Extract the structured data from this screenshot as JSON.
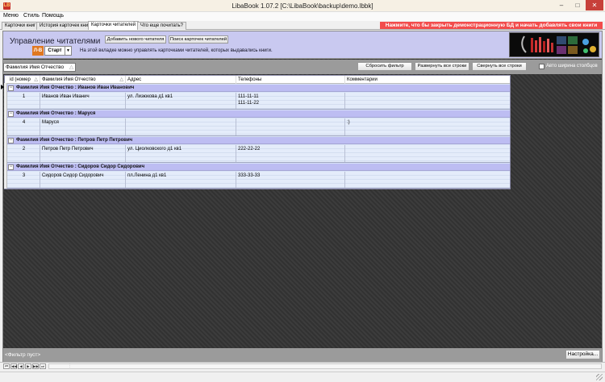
{
  "window": {
    "title": "LibaBook 1.07.2 [C:\\LibaBook\\backup\\demo.lbbk]",
    "app_icon": "LB",
    "minimize": "–",
    "maximize": "□",
    "close": "✕"
  },
  "menu": [
    "Меню",
    "Стиль",
    "Помощь"
  ],
  "tabs": [
    "Карточки книг",
    "История карточек книг",
    "Карточки читателей",
    "Что еще почитать?"
  ],
  "demo_banner": "Нажмите, что бы закрыть демонстрационную БД и начать добавлять свои книги",
  "panel": {
    "title": "Управление читателями",
    "add_button": "Добавить нового читателя",
    "search_button": "Поиск карточек читателей",
    "start_icon": "Л-В",
    "start_label": "Старт",
    "start_arrow": "▼",
    "description": "На этой вкладке можно управлять карточками читателей, которых выдавались книги."
  },
  "toolbar": {
    "filter_field": "Фамилия Имя Отчество",
    "sort_glyph": "△",
    "reset_filter": "Сбросить фильтр",
    "expand_all": "Развернуть все строки",
    "collapse_all": "Свернуть все строки",
    "auto_width_label": "Авто ширина столбцов"
  },
  "grid": {
    "columns": [
      "id (номер",
      "Фамилия Имя Отчество",
      "Адрес",
      "Телефоны",
      "Комментарии"
    ],
    "groups": [
      {
        "header": "Фамилия Имя Отчество : Иванов Иван Иванович",
        "expander": "−",
        "row": {
          "id": "1",
          "name": "Иванов Иван Иванич",
          "address": "ул. Лизюкова д1 кв1",
          "phone1": "111-11-11",
          "phone2": "111-11-22",
          "comment": ""
        }
      },
      {
        "header": "Фамилия Имя Отчество : Маруся",
        "expander": "−",
        "row": {
          "id": "4",
          "name": "Маруся",
          "address": "",
          "phone1": "",
          "phone2": "",
          "comment": ":)"
        }
      },
      {
        "header": "Фамилия Имя Отчество : Петров Петр Петрович",
        "expander": "−",
        "row": {
          "id": "2",
          "name": "Петров Петр Петрович",
          "address": "ул. Циолковского д1 кв1",
          "phone1": "222-22-22",
          "phone2": "",
          "comment": ""
        }
      },
      {
        "header": "Фамилия Имя Отчество : Сидоров Сидор Сидорович",
        "expander": "−",
        "row": {
          "id": "3",
          "name": "Сидоров Сидор Сидорович",
          "address": "пл.Ленина д1 кв1",
          "phone1": "333-33-33",
          "phone2": "",
          "comment": ""
        }
      }
    ]
  },
  "status": {
    "filter_text": "<Фильтр пуст>",
    "settings_button": "Настройка..."
  },
  "navigator": {
    "buttons": [
      "⏮",
      "◀◀",
      "◀",
      "▶",
      "▶▶",
      "⏭"
    ],
    "marker": "⋮"
  },
  "colors": {
    "demo_banner": "#f24c4c",
    "panel_bg": "#c9c9f0",
    "group_row": "#bdbdf2",
    "close_button": "#c7403a"
  }
}
